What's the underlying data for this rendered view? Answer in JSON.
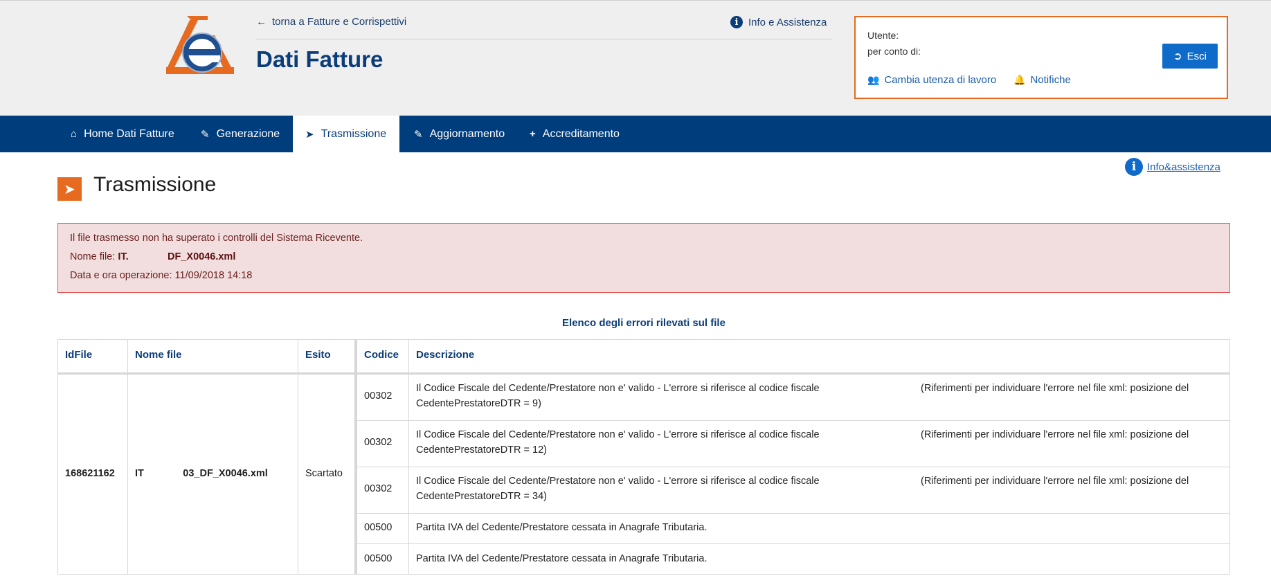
{
  "header": {
    "back_link": "torna a Fatture e Corrispettivi",
    "info_link": "Info e Assistenza",
    "app_title": "Dati Fatture",
    "user_label": "Utente:",
    "on_behalf_label": "per conto di:",
    "logout_label": "Esci",
    "change_user_label": "Cambia utenza di lavoro",
    "notifications_label": "Notifiche"
  },
  "nav": {
    "items": [
      {
        "label": "Home Dati Fatture",
        "icon": "home-icon"
      },
      {
        "label": "Generazione",
        "icon": "pencil-icon"
      },
      {
        "label": "Trasmissione",
        "icon": "paper-plane-icon",
        "active": true
      },
      {
        "label": "Aggiornamento",
        "icon": "pencil-icon"
      },
      {
        "label": "Accreditamento",
        "icon": "plus-icon"
      }
    ]
  },
  "page": {
    "title": "Trasmissione",
    "info_link": "Info&assistenza"
  },
  "alert": {
    "message": "Il file trasmesso non ha superato i controlli del Sistema Ricevente.",
    "file_label": "Nome file:",
    "file_name": "IT.              DF_X0046.xml",
    "date_label": "Data e ora operazione:",
    "date_value": "11/09/2018 14:18"
  },
  "errors": {
    "heading": "Elenco degli errori rilevati sul file",
    "columns": {
      "idfile": "IdFile",
      "nome_file": "Nome file",
      "esito": "Esito",
      "codice": "Codice",
      "descrizione": "Descrizione"
    },
    "file": {
      "id": "168621162",
      "name": "IT              03_DF_X0046.xml",
      "esito": "Scartato"
    },
    "rows": [
      {
        "code": "00302",
        "desc1": "Il Codice Fiscale del Cedente/Prestatore non e' valido - L'errore si riferisce al codice fiscale",
        "desc2": "(Riferimenti per individuare l'errore nel file xml: posizione del",
        "desc3": "CedentePrestatoreDTR = 9)"
      },
      {
        "code": "00302",
        "desc1": "Il Codice Fiscale del Cedente/Prestatore non e' valido - L'errore si riferisce al codice fiscale",
        "desc2": "(Riferimenti per individuare l'errore nel file xml: posizione del",
        "desc3": "CedentePrestatoreDTR = 12)"
      },
      {
        "code": "00302",
        "desc1": "Il Codice Fiscale del Cedente/Prestatore non e' valido - L'errore si riferisce al codice fiscale",
        "desc2": "(Riferimenti per individuare l'errore nel file xml: posizione del",
        "desc3": "CedentePrestatoreDTR = 34)"
      },
      {
        "code": "00500",
        "desc1": "Partita IVA del Cedente/Prestatore cessata in Anagrafe Tributaria.",
        "desc2": "",
        "desc3": ""
      },
      {
        "code": "00500",
        "desc1": "Partita IVA del Cedente/Prestatore cessata in Anagrafe Tributaria.",
        "desc2": "",
        "desc3": ""
      }
    ]
  }
}
